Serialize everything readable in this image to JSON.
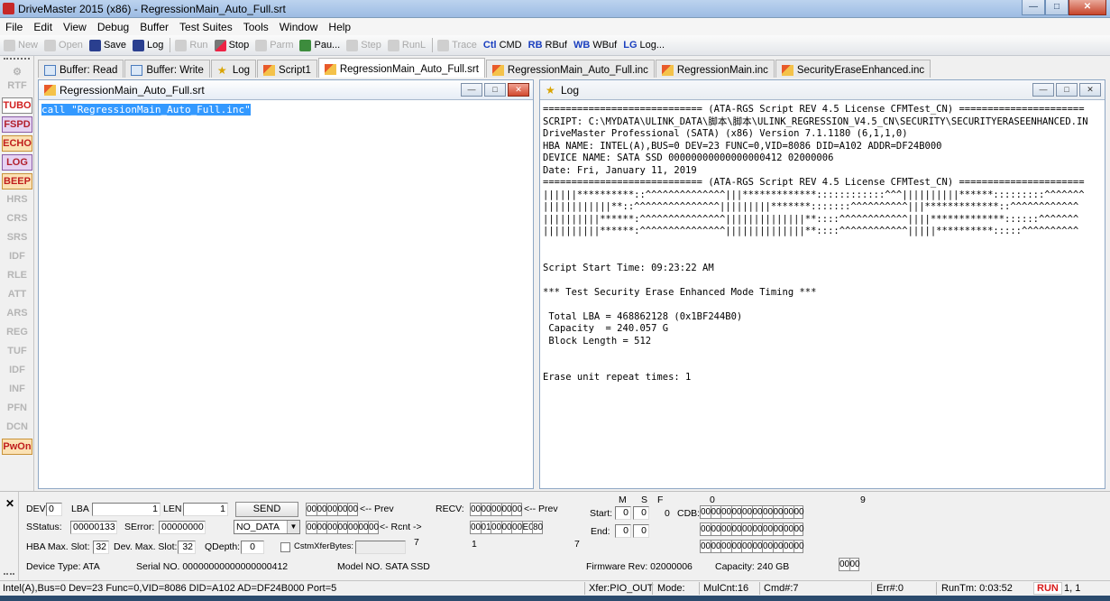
{
  "window": {
    "title": "DriveMaster 2015 (x86) - RegressionMain_Auto_Full.srt"
  },
  "menu": [
    "File",
    "Edit",
    "View",
    "Debug",
    "Buffer",
    "Test Suites",
    "Tools",
    "Window",
    "Help"
  ],
  "toolbar": {
    "new": "New",
    "open": "Open",
    "save": "Save",
    "log": "Log",
    "run": "Run",
    "stop": "Stop",
    "parm": "Parm",
    "pause": "Pau...",
    "step": "Step",
    "runl": "RunL",
    "trace": "Trace",
    "ctl_tag": "Ctl",
    "cmd": "CMD",
    "rb_tag": "RB",
    "rbuf": "RBuf",
    "wb_tag": "WB",
    "wbuf": "WBuf",
    "lg_tag": "LG",
    "logdots": "Log..."
  },
  "tabs": [
    "Buffer: Read",
    "Buffer: Write",
    "Log",
    "Script1",
    "RegressionMain_Auto_Full.srt",
    "RegressionMain_Auto_Full.inc",
    "RegressionMain.inc",
    "SecurityEraseEnhanced.inc"
  ],
  "sidebar": [
    "RTF",
    "TUBO",
    "FSPD",
    "ECHO",
    "LOG",
    "BEEP",
    "HRS",
    "CRS",
    "SRS",
    "IDF",
    "RLE",
    "ATT",
    "ARS",
    "REG",
    "TUF",
    "IDF",
    "INF",
    "PFN",
    "DCN",
    "PwOn"
  ],
  "script_window": {
    "title": "RegressionMain_Auto_Full.srt",
    "line": "call \"RegressionMain_Auto_Full.inc\""
  },
  "log_window": {
    "title": "Log",
    "lines": [
      "============================ (ATA-RGS Script REV 4.5 License CFMTest_CN) ======================",
      "SCRIPT: C:\\MYDATA\\ULINK_DATA\\脚本\\脚本\\ULINK_REGRESSION_V4.5_CN\\SECURITY\\SECURITYERASEENHANCED.IN",
      "DriveMaster Professional (SATA) (x86) Version 7.1.1180 (6,1,1,0)",
      "HBA NAME: INTEL(A),BUS=0 DEV=23 FUNC=0,VID=8086 DID=A102 ADDR=DF24B000",
      "DEVICE NAME: SATA SSD 00000000000000000412 02000006",
      "Date: Fri, January 11, 2019",
      "============================ (ATA-RGS Script REV 4.5 License CFMTest_CN) ======================",
      "||||||**********::^^^^^^^^^^^^^^|||*************::::::::::::^^^||||||||||******:::::::::^^^^^^^",
      "||||||||||||**::^^^^^^^^^^^^^^^|||||||||*******:::::::^^^^^^^^^^|||*************::^^^^^^^^^^^^",
      "||||||||||******:^^^^^^^^^^^^^^^||||||||||||||**::::^^^^^^^^^^^^||||*************::::::^^^^^^^",
      "||||||||||******:^^^^^^^^^^^^^^^||||||||||||||**::::^^^^^^^^^^^^|||||**********:::::^^^^^^^^^^",
      "",
      "",
      "Script Start Time: 09:23:22 AM",
      "",
      "*** Test Security Erase Enhanced Mode Timing ***",
      "",
      " Total LBA = 468862128 (0x1BF244B0)",
      " Capacity  = 240.057 G",
      " Block Length = 512",
      "",
      "",
      "Erase unit repeat times: 1"
    ]
  },
  "cmd": {
    "dev_label": "DEV",
    "dev": "0",
    "lba_label": "LBA",
    "lba": "1",
    "len_label": "LEN",
    "len": "1",
    "send": "SEND",
    "prev1": "<-- Prev",
    "recv_label": "RECV:",
    "prev2": "<-- Prev",
    "rcnt": "<- Rcnt ->",
    "send_bytes1": [
      "00",
      "00",
      "00",
      "00",
      "00"
    ],
    "send_bytes2": [
      "00",
      "00",
      "00",
      "00",
      "00",
      "00",
      "00"
    ],
    "recv_bytes1": [
      "00",
      "00",
      "00",
      "00",
      "00"
    ],
    "recv_bytes2": [
      "00",
      "01",
      "00",
      "00",
      "00",
      "E0",
      "80"
    ],
    "sstatus_label": "SStatus:",
    "sstatus": "00000133",
    "serror_label": "SError:",
    "serror": "00000000",
    "protocol": "NO_DATA",
    "hba_slot_label": "HBA Max. Slot:",
    "hba_slot": "32",
    "dev_slot_label": "Dev. Max. Slot:",
    "dev_slot": "32",
    "qdepth_label": "QDepth:",
    "qdepth": "0",
    "cstm_label": "CstmXferBytes:",
    "num7a": "7",
    "num1": "1",
    "num7b": "7",
    "m_label": "M",
    "s_label": "S",
    "f_label": "F",
    "start_label": "Start:",
    "start_vals": [
      "0",
      "0",
      "0"
    ],
    "end_label": "End:",
    "end_vals": [
      "0",
      "0"
    ],
    "cdb_label": "CDB:",
    "cdb_0": "0",
    "cdb_9": "9",
    "cdb_row1": [
      "00",
      "00",
      "00",
      "00",
      "00",
      "00",
      "00",
      "00",
      "00",
      "00"
    ],
    "cdb_row2": [
      "00",
      "00",
      "00",
      "00",
      "00",
      "00",
      "00",
      "00",
      "00",
      "00"
    ],
    "cdb_row3": [
      "00",
      "00",
      "00",
      "00",
      "00",
      "00",
      "00",
      "00",
      "00",
      "00"
    ],
    "cdb_row4": [
      "00",
      "00"
    ],
    "device_type": "Device Type:  ATA",
    "serial": "Serial NO.  00000000000000000412",
    "model": "Model NO.  SATA SSD",
    "firmware": "Firmware Rev:  02000006",
    "capacity": "Capacity:  240 GB"
  },
  "status": {
    "info": "Intel(A),Bus=0 Dev=23 Func=0,VID=8086 DID=A102 AD=DF24B000 Port=5",
    "xfer": "Xfer:PIO_OUT",
    "mode": "Mode:",
    "mulcnt": "MulCnt:16",
    "cmd": "Cmd#:7",
    "err": "Err#:0",
    "runtm": "RunTm: 0:03:52",
    "run": "RUN",
    "pos": "1, 1"
  },
  "colors": {
    "selection": "#3399ff",
    "run": "#d81b1b",
    "accent_red": "#d12020"
  }
}
